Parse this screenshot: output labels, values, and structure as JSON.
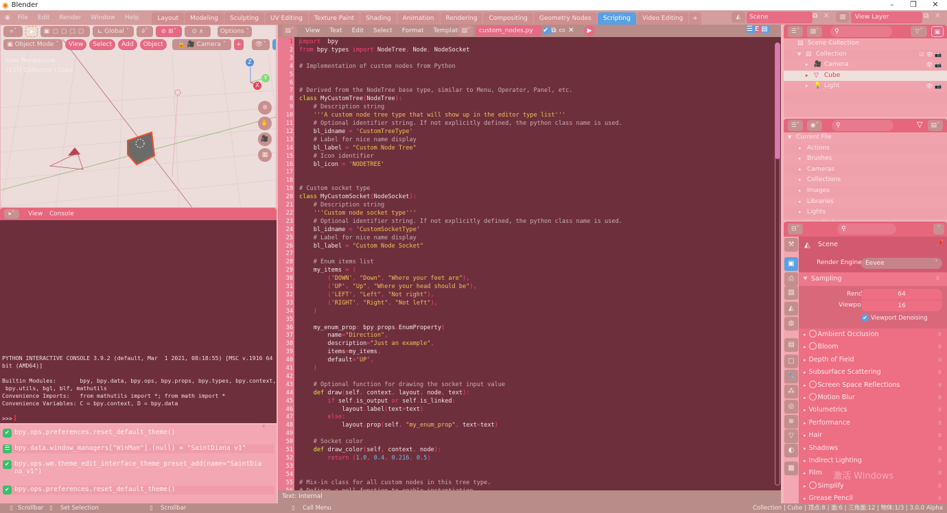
{
  "window": {
    "app_title": "Blender",
    "controls": {
      "minimize": "–",
      "maximize": "❐",
      "close": "✕"
    }
  },
  "menu": [
    "File",
    "Edit",
    "Render",
    "Window",
    "Help"
  ],
  "workspace_tabs": [
    {
      "label": "Layout",
      "active": false
    },
    {
      "label": "Modeling",
      "active": false
    },
    {
      "label": "Sculpting",
      "active": false
    },
    {
      "label": "UV Editing",
      "active": false
    },
    {
      "label": "Texture Paint",
      "active": false
    },
    {
      "label": "Shading",
      "active": false
    },
    {
      "label": "Animation",
      "active": false
    },
    {
      "label": "Rendering",
      "active": false
    },
    {
      "label": "Compositing",
      "active": false
    },
    {
      "label": "Geometry Nodes",
      "active": false
    },
    {
      "label": "Scripting",
      "active": true
    },
    {
      "label": "Video Editing",
      "active": false
    }
  ],
  "add_workspace": "+",
  "scene_selector": {
    "value": "Scene"
  },
  "view_layer_selector": {
    "value": "View Layer"
  },
  "viewport": {
    "toolbar": {
      "transform_orientation": "Global",
      "options": "Options"
    },
    "header": {
      "mode": "Object Mode",
      "view": "View",
      "select": "Select",
      "add": "Add",
      "object": "Object",
      "camera": "Camera"
    },
    "overlay_text": {
      "perspective": "User Perspective",
      "collection": "(237) Collection | Cube"
    },
    "gizmo": {
      "z": "Z",
      "y": "Y",
      "x": "X"
    }
  },
  "console": {
    "header": {
      "view": "View",
      "console": "Console"
    },
    "output": [
      "PYTHON INTERACTIVE CONSOLE 3.9.2 (default, Mar  1 2021, 08:18:55) [MSC v.1916 64",
      "bit (AMD64)]",
      "",
      "Builtin Modules:       bpy, bpy.data, bpy.ops, bpy.props, bpy.types, bpy.context,",
      " bpy.utils, bgl, blf, mathutils",
      "Convenience Imports:   from mathutils import *; from math import *",
      "Convenience Variables: C = bpy.context, D = bpy.data",
      "",
      ">>> "
    ]
  },
  "info_log": [
    {
      "icon": "check",
      "text": "bpy.ops.preferences.reset_default_theme()"
    },
    {
      "icon": "property",
      "text": "bpy.data.window_managers[\"WinMan\"].(null) = \"SaintDiana v1\""
    },
    {
      "icon": "check",
      "text": "bpy.ops.wm.theme_edit_interface_theme_preset_add(name=\"SaintDia\nna_v1\")"
    },
    {
      "icon": "check",
      "text": "bpy.ops.preferences.reset_default_theme()"
    }
  ],
  "text_editor": {
    "menu": [
      "View",
      "Text",
      "Edit",
      "Select",
      "Format",
      "Templates"
    ],
    "filename": "custom_nodes.py",
    "footer": "Text: Internal",
    "scroll_position": 0.26,
    "lines": [
      [
        [
          "kw",
          "import"
        ],
        [
          "",
          "  bpy"
        ]
      ],
      [
        [
          "kw",
          "from"
        ],
        [
          "",
          " bpy"
        ],
        [
          "op",
          "."
        ],
        [
          "",
          "types "
        ],
        [
          "kw",
          "import"
        ],
        [
          "",
          " NodeTree"
        ],
        [
          "op",
          ","
        ],
        [
          "",
          " Node"
        ],
        [
          "op",
          ","
        ],
        [
          "",
          " NodeSocket"
        ]
      ],
      [],
      [
        [
          "cm",
          "# Implementation of custom nodes from Python"
        ]
      ],
      [],
      [],
      [
        [
          "cm",
          "# Derived from the NodeTree base type, similar to Menu, Operator, Panel, etc."
        ]
      ],
      [
        [
          "cls",
          "class"
        ],
        [
          "",
          " MyCustomTree"
        ],
        [
          "op",
          "("
        ],
        [
          "",
          "NodeTree"
        ],
        [
          "op",
          "):"
        ]
      ],
      [
        [
          "cm",
          "    # Description string"
        ]
      ],
      [
        [
          "str",
          "    '''A custom node tree type that will show up in the editor type list'''"
        ]
      ],
      [
        [
          "cm",
          "    # Optional identifier string. If not explicitly defined, the python class name is used."
        ]
      ],
      [
        [
          "",
          "    bl_idname "
        ],
        [
          "op",
          "="
        ],
        [
          "str",
          " 'CustomTreeType'"
        ]
      ],
      [
        [
          "cm",
          "    # Label for nice name display"
        ]
      ],
      [
        [
          "",
          "    bl_label "
        ],
        [
          "op",
          "="
        ],
        [
          "str",
          " \"Custom Node Tree\""
        ]
      ],
      [
        [
          "cm",
          "    # Icon identifier"
        ]
      ],
      [
        [
          "",
          "    bl_icon "
        ],
        [
          "op",
          "="
        ],
        [
          "str",
          " 'NODETREE'"
        ]
      ],
      [],
      [],
      [
        [
          "cm",
          "# Custom socket type"
        ]
      ],
      [
        [
          "cls",
          "class"
        ],
        [
          "",
          " MyCustomSocket"
        ],
        [
          "op",
          "("
        ],
        [
          "",
          "NodeSocket"
        ],
        [
          "op",
          "):"
        ]
      ],
      [
        [
          "cm",
          "    # Description string"
        ]
      ],
      [
        [
          "str",
          "    '''Custom node socket type'''"
        ]
      ],
      [
        [
          "cm",
          "    # Optional identifier string. If not explicitly defined, the python class name is used."
        ]
      ],
      [
        [
          "",
          "    bl_idname "
        ],
        [
          "op",
          "="
        ],
        [
          "str",
          " 'CustomSocketType'"
        ]
      ],
      [
        [
          "cm",
          "    # Label for nice name display"
        ]
      ],
      [
        [
          "",
          "    bl_label "
        ],
        [
          "op",
          "="
        ],
        [
          "str",
          " \"Custom Node Socket\""
        ]
      ],
      [],
      [
        [
          "cm",
          "    # Enum items list"
        ]
      ],
      [
        [
          "",
          "    my_items "
        ],
        [
          "op",
          "= ("
        ]
      ],
      [
        [
          "op",
          "        ("
        ],
        [
          "str",
          "'DOWN'"
        ],
        [
          "op",
          ", "
        ],
        [
          "str",
          "\"Down\""
        ],
        [
          "op",
          ", "
        ],
        [
          "str",
          "\"Where your feet are\""
        ],
        [
          "op",
          "),"
        ]
      ],
      [
        [
          "op",
          "        ("
        ],
        [
          "str",
          "'UP'"
        ],
        [
          "op",
          ", "
        ],
        [
          "str",
          "\"Up\""
        ],
        [
          "op",
          ", "
        ],
        [
          "str",
          "\"Where your head should be\""
        ],
        [
          "op",
          "),"
        ]
      ],
      [
        [
          "op",
          "        ("
        ],
        [
          "str",
          "'LEFT'"
        ],
        [
          "op",
          ", "
        ],
        [
          "str",
          "\"Left\""
        ],
        [
          "op",
          ", "
        ],
        [
          "str",
          "\"Not right\""
        ],
        [
          "op",
          "),"
        ]
      ],
      [
        [
          "op",
          "        ("
        ],
        [
          "str",
          "'RIGHT'"
        ],
        [
          "op",
          ", "
        ],
        [
          "str",
          "\"Right\""
        ],
        [
          "op",
          ", "
        ],
        [
          "str",
          "\"Not left\""
        ],
        [
          "op",
          "),"
        ]
      ],
      [
        [
          "op",
          "    )"
        ]
      ],
      [],
      [
        [
          "",
          "    my_enum_prop"
        ],
        [
          "op",
          ":"
        ],
        [
          "",
          " bpy"
        ],
        [
          "op",
          "."
        ],
        [
          "",
          "props"
        ],
        [
          "op",
          "."
        ],
        [
          "",
          "EnumProperty"
        ],
        [
          "op",
          "("
        ]
      ],
      [
        [
          "",
          "        name"
        ],
        [
          "op",
          "="
        ],
        [
          "str",
          "\"Direction\""
        ],
        [
          "op",
          ","
        ]
      ],
      [
        [
          "",
          "        description"
        ],
        [
          "op",
          "="
        ],
        [
          "str",
          "\"Just an example\""
        ],
        [
          "op",
          ","
        ]
      ],
      [
        [
          "",
          "        items"
        ],
        [
          "op",
          "="
        ],
        [
          "",
          "my_items"
        ],
        [
          "op",
          ","
        ]
      ],
      [
        [
          "",
          "        default"
        ],
        [
          "op",
          "="
        ],
        [
          "str",
          "'UP'"
        ],
        [
          "op",
          ","
        ]
      ],
      [
        [
          "op",
          "    )"
        ]
      ],
      [],
      [
        [
          "cm",
          "    # Optional function for drawing the socket input value"
        ]
      ],
      [
        [
          "cls",
          "    def"
        ],
        [
          "",
          " draw"
        ],
        [
          "op",
          "("
        ],
        [
          "",
          "self"
        ],
        [
          "op",
          ","
        ],
        [
          "",
          " context"
        ],
        [
          "op",
          ","
        ],
        [
          "",
          " layout"
        ],
        [
          "op",
          ","
        ],
        [
          "",
          " node"
        ],
        [
          "op",
          ","
        ],
        [
          "",
          " text"
        ],
        [
          "op",
          "):"
        ]
      ],
      [
        [
          "kw",
          "        if"
        ],
        [
          "",
          " self"
        ],
        [
          "op",
          "."
        ],
        [
          "",
          "is_output "
        ],
        [
          "kw",
          "or"
        ],
        [
          "",
          " self"
        ],
        [
          "op",
          "."
        ],
        [
          "",
          "is_linked"
        ],
        [
          "op",
          ":"
        ]
      ],
      [
        [
          "",
          "            layout"
        ],
        [
          "op",
          "."
        ],
        [
          "",
          "label"
        ],
        [
          "op",
          "("
        ],
        [
          "",
          "text"
        ],
        [
          "op",
          "="
        ],
        [
          "",
          "text"
        ],
        [
          "op",
          ")"
        ]
      ],
      [
        [
          "kw",
          "        else"
        ],
        [
          "op",
          ":"
        ]
      ],
      [
        [
          "",
          "            layout"
        ],
        [
          "op",
          "."
        ],
        [
          "",
          "prop"
        ],
        [
          "op",
          "("
        ],
        [
          "",
          "self"
        ],
        [
          "op",
          ","
        ],
        [
          "str",
          " \"my_enum_prop\""
        ],
        [
          "op",
          ","
        ],
        [
          "",
          " text"
        ],
        [
          "op",
          "="
        ],
        [
          "",
          "text"
        ],
        [
          "op",
          ")"
        ]
      ],
      [],
      [
        [
          "cm",
          "    # Socket color"
        ]
      ],
      [
        [
          "cls",
          "    def"
        ],
        [
          "",
          " draw_color"
        ],
        [
          "op",
          "("
        ],
        [
          "",
          "self"
        ],
        [
          "op",
          ","
        ],
        [
          "",
          " context"
        ],
        [
          "op",
          ","
        ],
        [
          "",
          " node"
        ],
        [
          "op",
          "):"
        ]
      ],
      [
        [
          "kw",
          "        return"
        ],
        [
          "op",
          " ("
        ],
        [
          "num",
          "1.0"
        ],
        [
          "op",
          ", "
        ],
        [
          "num",
          "0.4"
        ],
        [
          "op",
          ", "
        ],
        [
          "num",
          "0.216"
        ],
        [
          "op",
          ", "
        ],
        [
          "num",
          "0.5"
        ],
        [
          "op",
          ")"
        ]
      ],
      [],
      [],
      [
        [
          "cm",
          "# Mix-in class for all custom nodes in this tree type."
        ]
      ],
      [
        [
          "cm",
          "# Defines a poll function to enable instantiation."
        ]
      ]
    ]
  },
  "outliner": {
    "rows": [
      {
        "label": "Scene Collection",
        "icon": "▤",
        "indent": 0,
        "arrow": ""
      },
      {
        "label": "Collection",
        "icon": "▤",
        "indent": 1,
        "arrow": "▼",
        "controls": "☑ 👁 📷"
      },
      {
        "label": "Camera",
        "icon": "🎥",
        "indent": 2,
        "arrow": "▸",
        "controls": "👁 📷"
      },
      {
        "label": "Cube",
        "icon": "▽",
        "indent": 2,
        "arrow": "▸",
        "controls": "",
        "selected": true
      },
      {
        "label": "Light",
        "icon": "💡",
        "indent": 2,
        "arrow": "▸",
        "controls": "👁 📷"
      }
    ]
  },
  "file_browser": {
    "root": "Current File",
    "items": [
      "Actions",
      "Brushes",
      "Cameras",
      "Collections",
      "Images",
      "Libraries",
      "Lights",
      "Line Styles"
    ]
  },
  "properties": {
    "context": "Scene",
    "render_engine_label": "Render Engine",
    "render_engine": "Eevee",
    "sampling": {
      "title": "Sampling",
      "render_label": "Render",
      "render": "64",
      "viewport_label": "Viewport",
      "viewport": "16",
      "denoise_label": "Viewport Denoising",
      "denoise": true
    },
    "panels": [
      {
        "label": "Ambient Occlusion",
        "toggle": true
      },
      {
        "label": "Bloom",
        "toggle": true
      },
      {
        "label": "Depth of Field",
        "toggle": false
      },
      {
        "label": "Subsurface Scattering",
        "toggle": false
      },
      {
        "label": "Screen Space Reflections",
        "toggle": true
      },
      {
        "label": "Motion Blur",
        "toggle": true
      },
      {
        "label": "Volumetrics",
        "toggle": false
      },
      {
        "label": "Performance",
        "toggle": false
      },
      {
        "label": "Hair",
        "toggle": false
      },
      {
        "label": "Shadows",
        "toggle": false
      },
      {
        "label": "Indirect Lighting",
        "toggle": false
      },
      {
        "label": "Film",
        "toggle": false
      },
      {
        "label": "Simplify",
        "toggle": true
      },
      {
        "label": "Grease Pencil",
        "toggle": false
      }
    ],
    "watermark": "激活 Windows"
  },
  "statusbar": {
    "hints": [
      "Scrollbar",
      "Set Selection",
      "Scrollbar",
      "Call Menu"
    ],
    "stats": "Collection | Cube | 顶点:8 | 面:6 | 三角面:12 | 物体:1/3 | 3.0.0 Alpha"
  },
  "colors": {
    "accent": "#5aa0e2",
    "header": "#e6667c",
    "editor_bg": "#6e2f3c",
    "panel_bg": "#ee6e84"
  }
}
